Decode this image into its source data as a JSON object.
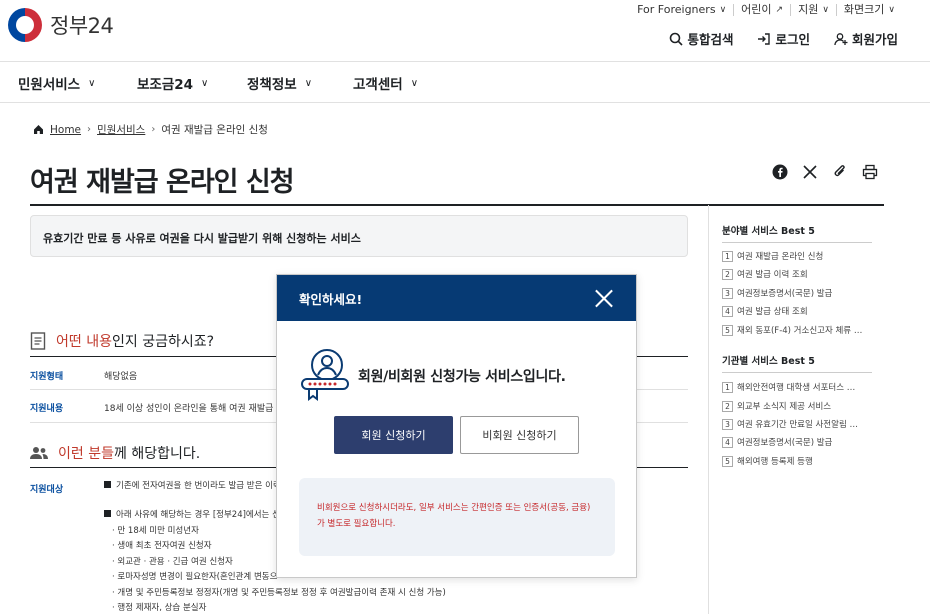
{
  "header": {
    "logo_text": "정부24",
    "utility": [
      {
        "label": "For Foreigners"
      },
      {
        "label": "어린이"
      },
      {
        "label": "지원"
      },
      {
        "label": "화면크기"
      }
    ],
    "actions": {
      "search": "통합검색",
      "login": "로그인",
      "signup": "회원가입"
    }
  },
  "gnb": [
    "민원서비스",
    "보조금24",
    "정책정보",
    "고객센터"
  ],
  "breadcrumb": {
    "home": "Home",
    "level1": "민원서비스",
    "current": "여권 재발급 온라인 신청"
  },
  "page_title": "여권 재발급 온라인 신청",
  "summary": "유효기간 만료 등 사유로 여권을 다시 발급받기 위해 신청하는 서비스",
  "section1": {
    "hl": "어떤 내용",
    "rest": "인지 궁금하시죠?"
  },
  "rows": [
    {
      "label": "지원형태",
      "value": "해당없음"
    },
    {
      "label": "지원내용",
      "value": "18세 이상 성인이 온라인을 통해 여권 재발급 신청"
    }
  ],
  "section2": {
    "hl": "이런 분들",
    "rest": "께 해당합니다."
  },
  "target": {
    "label": "지원대상",
    "line1": "기존에 전자여권을 한 번이라도 발급 받은 이력",
    "line2": "아래 사유에 해당하는 경우 [정부24]에서는 신청",
    "subs": [
      "만 18세 미만 미성년자",
      "생애 최초 전자여권 신청자",
      "외교관 · 관용 · 긴급 여권 신청자",
      "로마자성명 변경이 필요한자(혼인관계 변동으",
      "개명 및 주민등록정보 정정자(개명 및 주민등록정보 정정 후 여권발급이력 존재 시 신청 가능)",
      "행정 제재자, 상습 분실자"
    ]
  },
  "sidebar": {
    "best_by_field_title": "분야별 서비스 Best 5",
    "best_by_field": [
      "여권 재발급 온라인 신청",
      "여권 발급 이력 조회",
      "여권정보증명서(국문) 발급",
      "여권 발급 상태 조회",
      "재외 동포(F-4) 거소신고자 체류 …"
    ],
    "best_by_agency_title": "기관별 서비스 Best 5",
    "best_by_agency": [
      "해외안전여행 대학생 서포터스 …",
      "외교부 소식지 제공 서비스",
      "여권 유효기간 만료일 사전알림 …",
      "여권정보증명서(국문) 발급",
      "해외여행 등록제 등행"
    ]
  },
  "modal": {
    "title": "확인하세요!",
    "message": "회원/비회원 신청가능 서비스입니다.",
    "primary": "회원 신청하기",
    "secondary": "비회원 신청하기",
    "notice": "비회원으로 신청하시더라도, 일부 서비스는 간편인증 또는 인증서(공동, 금융)가 별도로 필요합니다."
  }
}
